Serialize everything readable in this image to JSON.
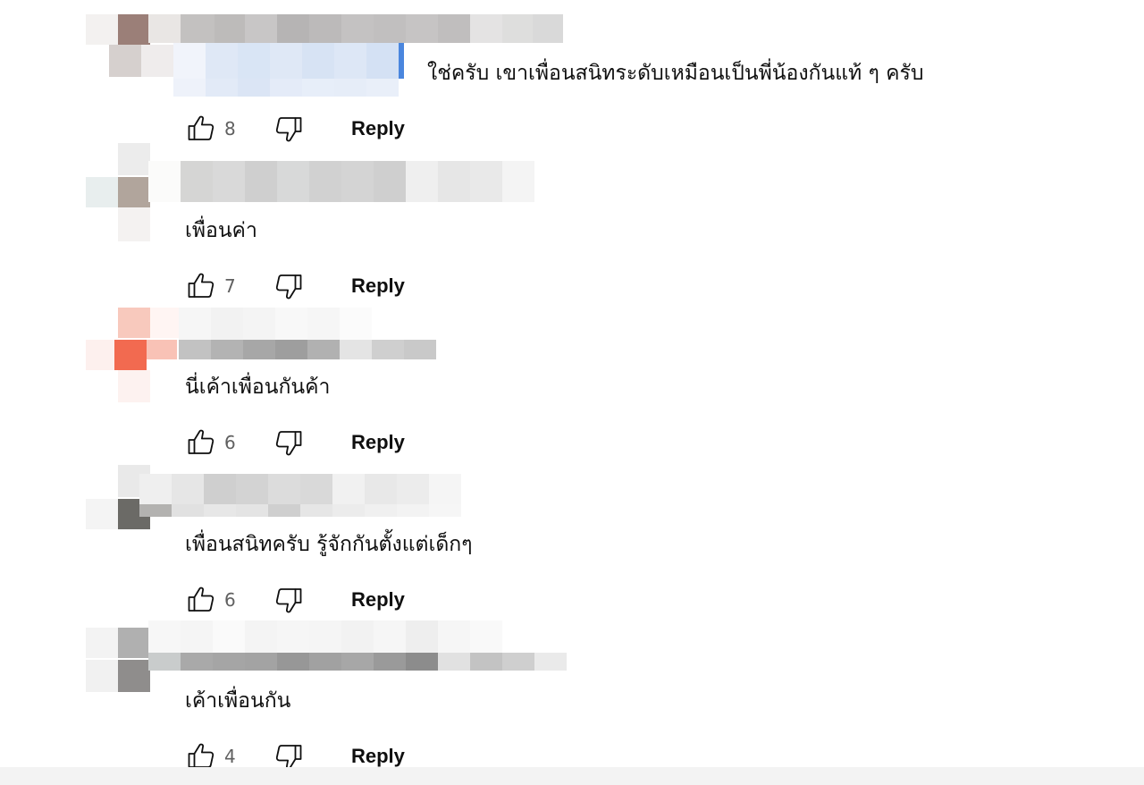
{
  "comments": [
    {
      "text": "ใช่ครับ เขาเพื่อนสนิทระดับเหมือนเป็นพี่น้องกันแท้ ๆ ครับ",
      "likes": "8",
      "reply_label": "Reply",
      "avatar_color": "#9b7f78",
      "has_mention": true
    },
    {
      "text": "เพื่อนค่า",
      "likes": "7",
      "reply_label": "Reply",
      "avatar_color": "#b1a59c"
    },
    {
      "text": "นี่เค้าเพื่อนกันค้า",
      "likes": "6",
      "reply_label": "Reply",
      "avatar_color": "#f26a50"
    },
    {
      "text": "เพื่อนสนิทครับ รู้จักกันตั้งแต่เด็กๆ",
      "likes": "6",
      "reply_label": "Reply",
      "avatar_color": "#6b6a66"
    },
    {
      "text": "เค้าเพื่อนกัน",
      "likes": "4",
      "reply_label": "Reply",
      "avatar_color": "#8f8d8c"
    }
  ],
  "icons": {
    "like": "thumbs-up-icon",
    "dislike": "thumbs-down-icon"
  },
  "colors": {
    "mention": "#2a6fd6",
    "count": "#606060",
    "text": "#0f0f0f"
  }
}
